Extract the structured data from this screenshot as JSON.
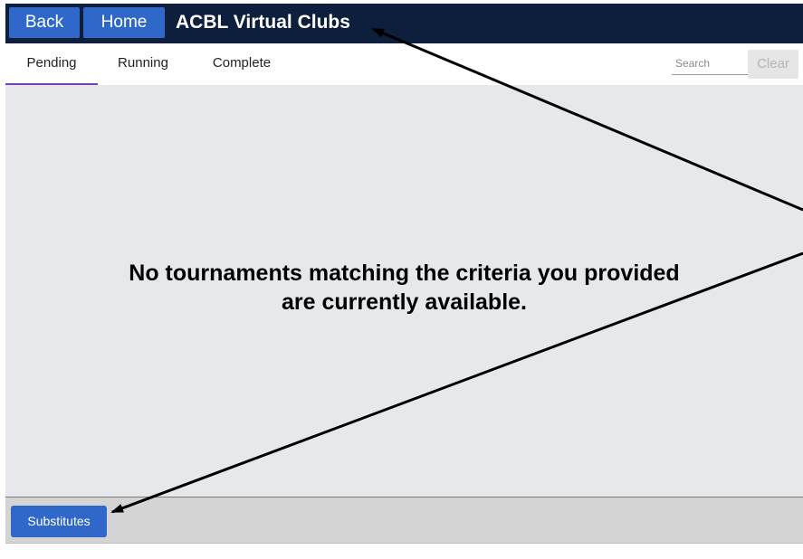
{
  "header": {
    "back_label": "Back",
    "home_label": "Home",
    "title": "ACBL Virtual Clubs",
    "colors": {
      "bar": "#0d1f3c",
      "button": "#2f68c8"
    }
  },
  "tabs": [
    {
      "label": "Pending",
      "active": true
    },
    {
      "label": "Running",
      "active": false
    },
    {
      "label": "Complete",
      "active": false
    }
  ],
  "search": {
    "placeholder": "Search",
    "value": ""
  },
  "clear_label": "Clear",
  "main": {
    "empty_message_line1": "No tournaments matching the criteria you provided",
    "empty_message_line2": "are currently available."
  },
  "footer": {
    "substitutes_label": "Substitutes"
  },
  "annotations": {
    "arrows": [
      {
        "from": "right-edge",
        "to": "app-title"
      },
      {
        "from": "right-edge",
        "to": "substitutes-button"
      }
    ],
    "color": "#000000"
  }
}
